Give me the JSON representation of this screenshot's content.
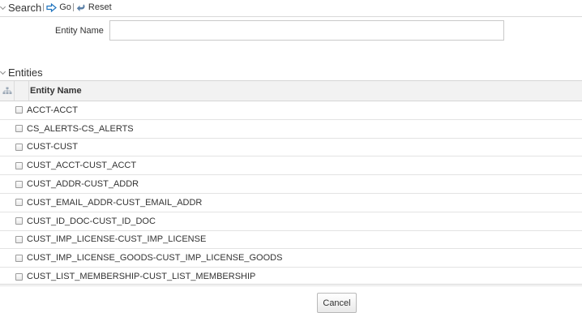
{
  "search": {
    "title": "Search",
    "go_label": "Go",
    "reset_label": "Reset",
    "entity_name_label": "Entity Name",
    "entity_name_value": ""
  },
  "entities": {
    "title": "Entities",
    "column_header": "Entity Name",
    "rows": [
      "ACCT-ACCT",
      "CS_ALERTS-CS_ALERTS",
      "CUST-CUST",
      "CUST_ACCT-CUST_ACCT",
      "CUST_ADDR-CUST_ADDR",
      "CUST_EMAIL_ADDR-CUST_EMAIL_ADDR",
      "CUST_ID_DOC-CUST_ID_DOC",
      "CUST_IMP_LICENSE-CUST_IMP_LICENSE",
      "CUST_IMP_LICENSE_GOODS-CUST_IMP_LICENSE_GOODS",
      "CUST_LIST_MEMBERSHIP-CUST_LIST_MEMBERSHIP"
    ]
  },
  "footer": {
    "cancel_label": "Cancel"
  },
  "icons": {
    "go": "arrow-right-icon",
    "reset": "reset-arrow-icon",
    "tree": "hierarchy-icon",
    "collapse": "chevron-down-icon"
  },
  "colors": {
    "go_icon": "#1e73be",
    "header_bg": "#f2f2f2"
  }
}
